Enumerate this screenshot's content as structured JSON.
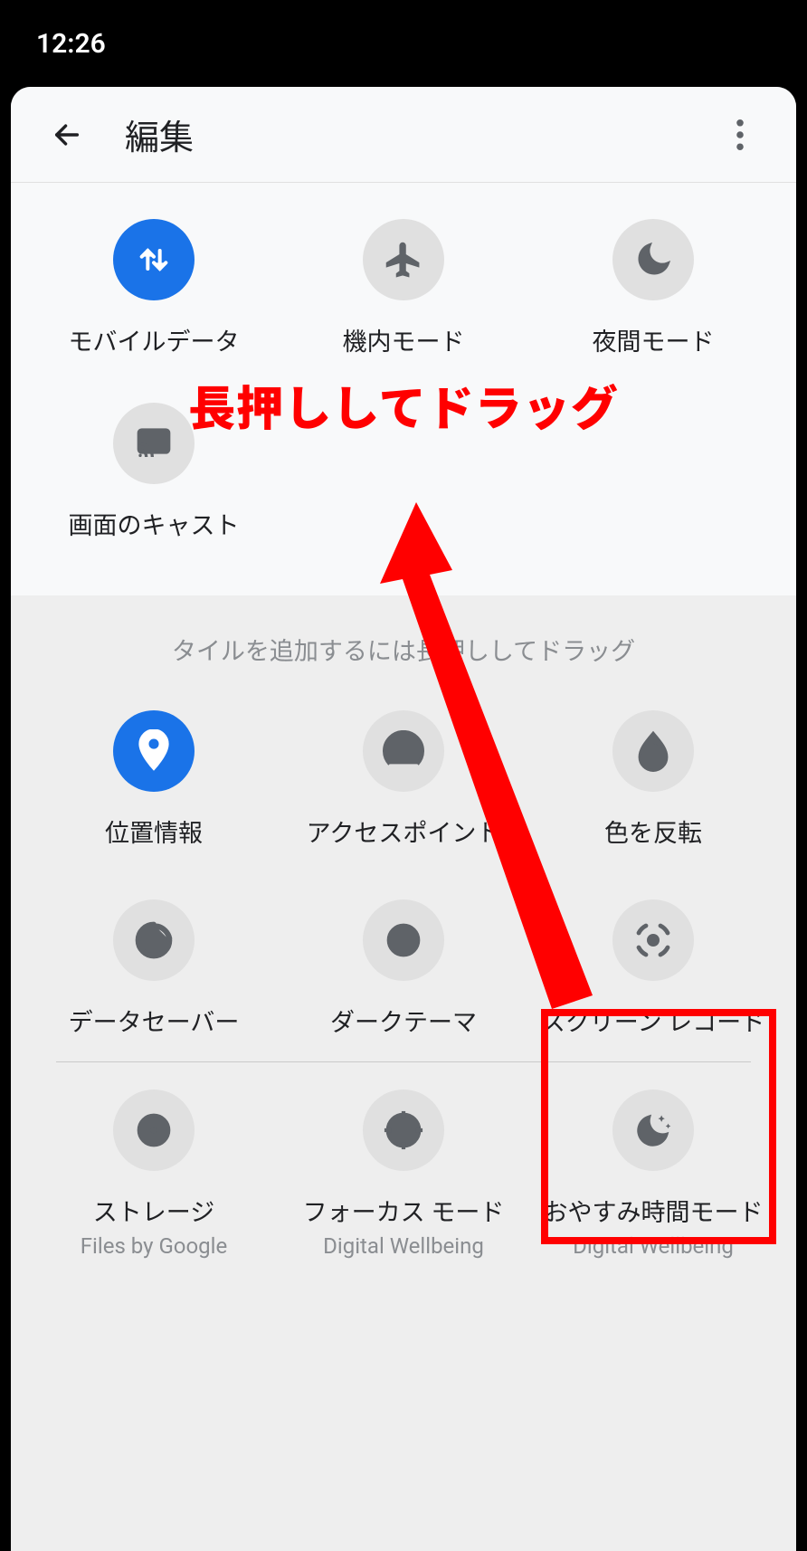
{
  "status": {
    "time": "12:26"
  },
  "header": {
    "title": "編集"
  },
  "top_tiles": [
    {
      "label": "モバイルデータ",
      "icon": "data",
      "active": true
    },
    {
      "label": "機内モード",
      "icon": "airplane",
      "active": false
    },
    {
      "label": "夜間モード",
      "icon": "moon",
      "active": false
    },
    {
      "label": "画面のキャスト",
      "icon": "cast",
      "active": false
    }
  ],
  "hint_text": "タイルを追加するには長押ししてドラッグ",
  "bottom_tiles_1": [
    {
      "label": "位置情報",
      "icon": "location",
      "active": true
    },
    {
      "label": "アクセスポイント",
      "icon": "hotspot",
      "active": false
    },
    {
      "label": "色を反転",
      "icon": "invert",
      "active": false
    }
  ],
  "bottom_tiles_2": [
    {
      "label": "データセーバー",
      "icon": "datasaver",
      "active": false
    },
    {
      "label": "ダークテーマ",
      "icon": "dark",
      "active": false
    },
    {
      "label": "スクリーン レコード",
      "icon": "record",
      "active": false
    }
  ],
  "bottom_tiles_3": [
    {
      "label": "ストレージ",
      "sublabel": "Files by Google",
      "icon": "storage",
      "active": false
    },
    {
      "label": "フォーカス モード",
      "sublabel": "Digital Wellbeing",
      "icon": "focus",
      "active": false
    },
    {
      "label": "おやすみ時間モード",
      "sublabel": "Digital Wellbeing",
      "icon": "bedtime",
      "active": false
    }
  ],
  "annotation": {
    "text": "長押ししてドラッグ"
  }
}
